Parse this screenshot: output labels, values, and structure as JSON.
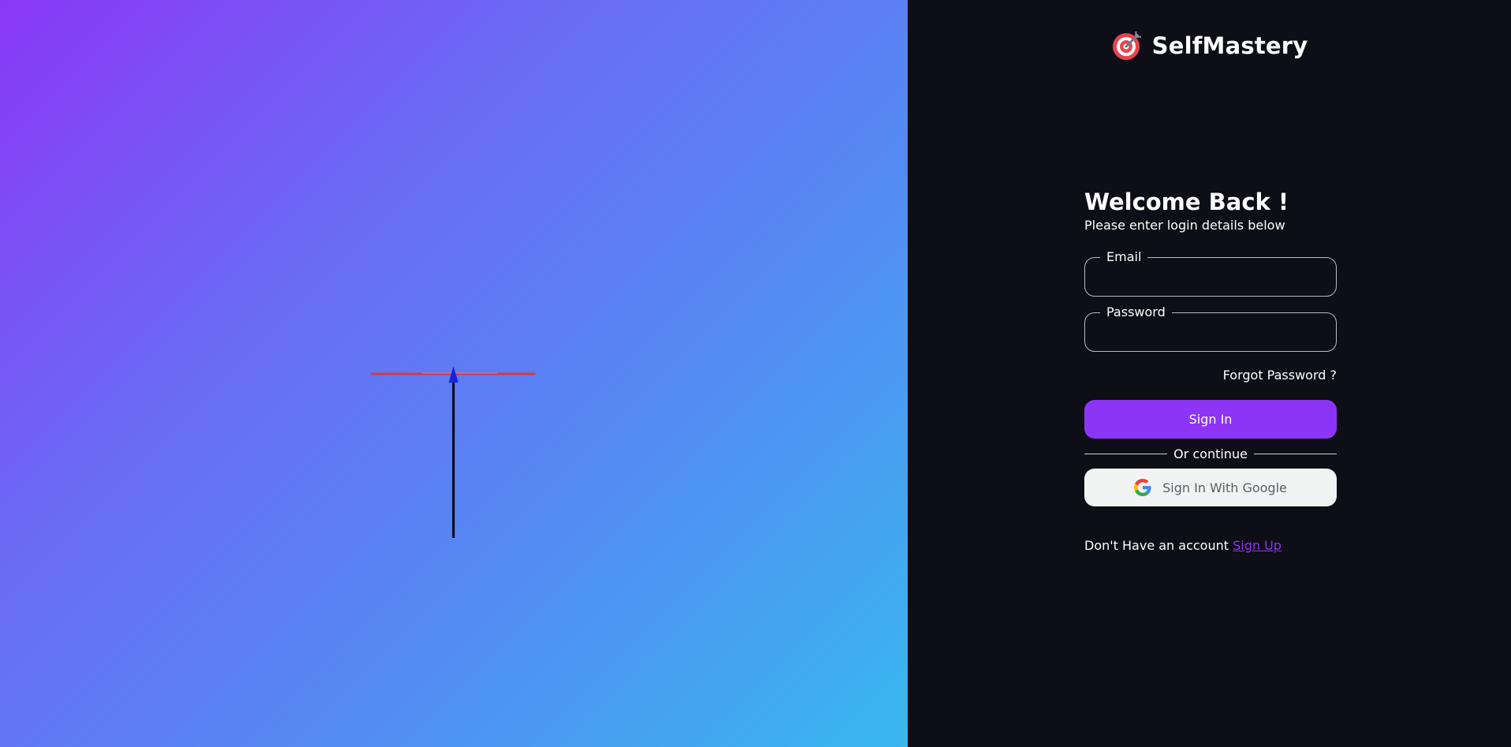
{
  "brand": {
    "name": "SelfMastery",
    "logo_icon": "target-dart-icon"
  },
  "login": {
    "title": "Welcome Back !",
    "subtitle": "Please enter login details below",
    "email_label": "Email",
    "email_value": "",
    "password_label": "Password",
    "password_value": "",
    "forgot_label": "Forgot Password ?",
    "signin_label": "Sign In",
    "divider_label": "Or continue",
    "google_label": "Sign In With Google",
    "google_icon": "google-icon",
    "signup_prompt": "Don't Have an account",
    "signup_label": "Sign Up"
  },
  "colors": {
    "hero_gradient": [
      "#8a38f5",
      "#6a6cf5",
      "#548bf3",
      "#38b8ef"
    ],
    "panel_bg": "#0e0e16",
    "accent": "#8c35f6",
    "google_button_bg": "#f1f3f3"
  }
}
